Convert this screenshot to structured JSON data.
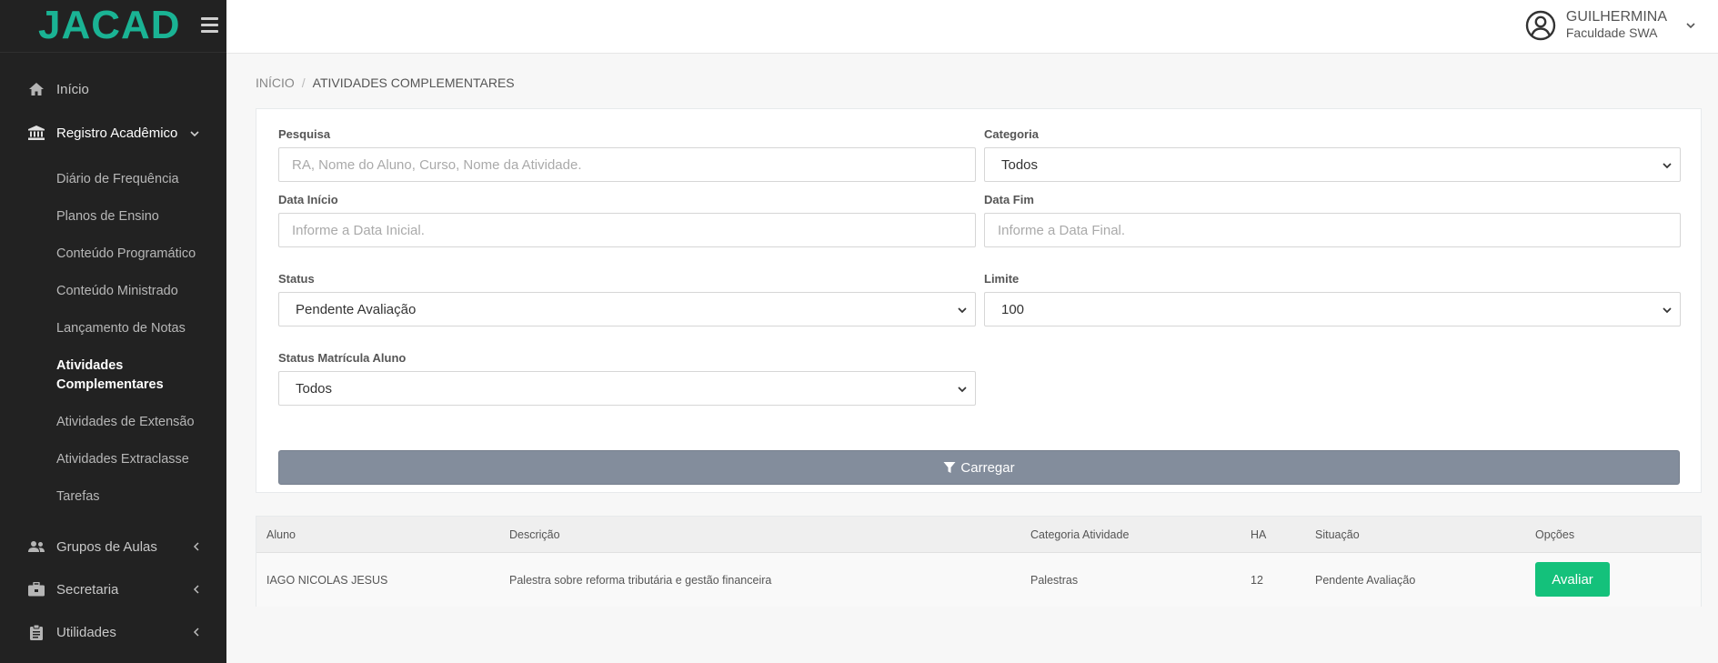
{
  "brand": {
    "logo": "JACAD",
    "color": "#1ab394"
  },
  "user": {
    "name": "GUILHERMINA",
    "institution": "Faculdade SWA"
  },
  "sidebar": {
    "items": [
      {
        "label": "Início",
        "icon": "home-icon"
      },
      {
        "label": "Registro Acadêmico",
        "icon": "bank-icon"
      },
      {
        "label": "Grupos de Aulas",
        "icon": "users-icon"
      },
      {
        "label": "Secretaria",
        "icon": "briefcase-icon"
      },
      {
        "label": "Utilidades",
        "icon": "clipboard-icon"
      }
    ],
    "subitems": [
      "Diário de Frequência",
      "Planos de Ensino",
      "Conteúdo Programático",
      "Conteúdo Ministrado",
      "Lançamento de Notas",
      "Atividades Complementares",
      "Atividades de Extensão",
      "Atividades Extraclasse",
      "Tarefas"
    ]
  },
  "breadcrumb": {
    "home": "INÍCIO",
    "current": "ATIVIDADES COMPLEMENTARES"
  },
  "filters": {
    "pesquisa": {
      "label": "Pesquisa",
      "placeholder": "RA, Nome do Aluno, Curso, Nome da Atividade."
    },
    "categoria": {
      "label": "Categoria",
      "value": "Todos"
    },
    "data_inicio": {
      "label": "Data Início",
      "placeholder": "Informe a Data Inicial."
    },
    "data_fim": {
      "label": "Data Fim",
      "placeholder": "Informe a Data Final."
    },
    "status": {
      "label": "Status",
      "value": "Pendente Avaliação"
    },
    "limite": {
      "label": "Limite",
      "value": "100"
    },
    "status_matricula": {
      "label": "Status Matrícula Aluno",
      "value": "Todos"
    },
    "load_button": "Carregar"
  },
  "table": {
    "headers": [
      "Aluno",
      "Descrição",
      "Categoria Atividade",
      "HA",
      "Situação",
      "Opções"
    ],
    "rows": [
      {
        "aluno": "IAGO NICOLAS JESUS",
        "descricao": "Palestra sobre reforma tributária e gestão financeira",
        "categoria": "Palestras",
        "ha": "12",
        "situacao": "Pendente Avaliação",
        "action": "Avaliar"
      }
    ]
  },
  "colors": {
    "sidebar": "#222222",
    "button_load": "#838d9c",
    "button_avaliar": "#14c17b"
  }
}
